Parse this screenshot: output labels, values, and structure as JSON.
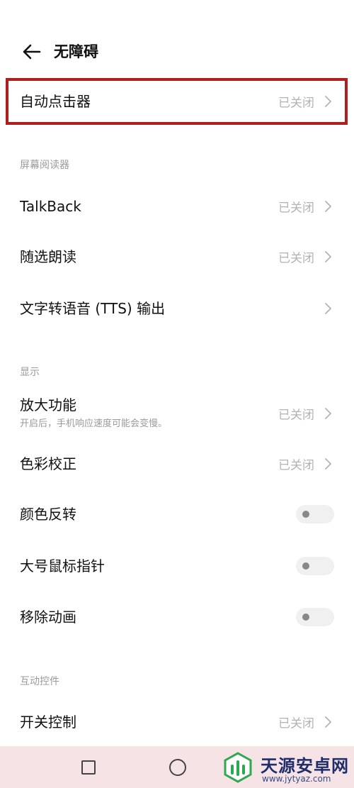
{
  "header": {
    "title": "无障碍"
  },
  "items": {
    "auto_clicker": {
      "label": "自动点击器",
      "status": "已关闭"
    },
    "talkback": {
      "label": "TalkBack",
      "status": "已关闭"
    },
    "select_to_speak": {
      "label": "随选朗读",
      "status": "已关闭"
    },
    "tts_output": {
      "label": "文字转语音 (TTS) 输出"
    },
    "magnification": {
      "label": "放大功能",
      "sub": "开启后，手机响应速度可能会变慢。",
      "status": "已关闭"
    },
    "color_correction": {
      "label": "色彩校正",
      "status": "已关闭"
    },
    "color_inversion": {
      "label": "颜色反转",
      "enabled": false
    },
    "large_pointer": {
      "label": "大号鼠标指针",
      "enabled": false
    },
    "remove_animations": {
      "label": "移除动画",
      "enabled": false
    },
    "switch_access": {
      "label": "开关控制",
      "status": "已关闭"
    }
  },
  "sections": {
    "screen_reader": "屏幕阅读器",
    "display": "显示",
    "interaction_controls": "互动控件"
  },
  "navbar": {
    "icons": [
      "recents-icon",
      "home-icon"
    ]
  },
  "watermark": {
    "name": "天源安卓网",
    "url": "www.jytyaz.com"
  },
  "colors": {
    "highlight": "#b01e1e",
    "navbar": "#f6e3e6",
    "status_text": "#b3b3b3"
  }
}
